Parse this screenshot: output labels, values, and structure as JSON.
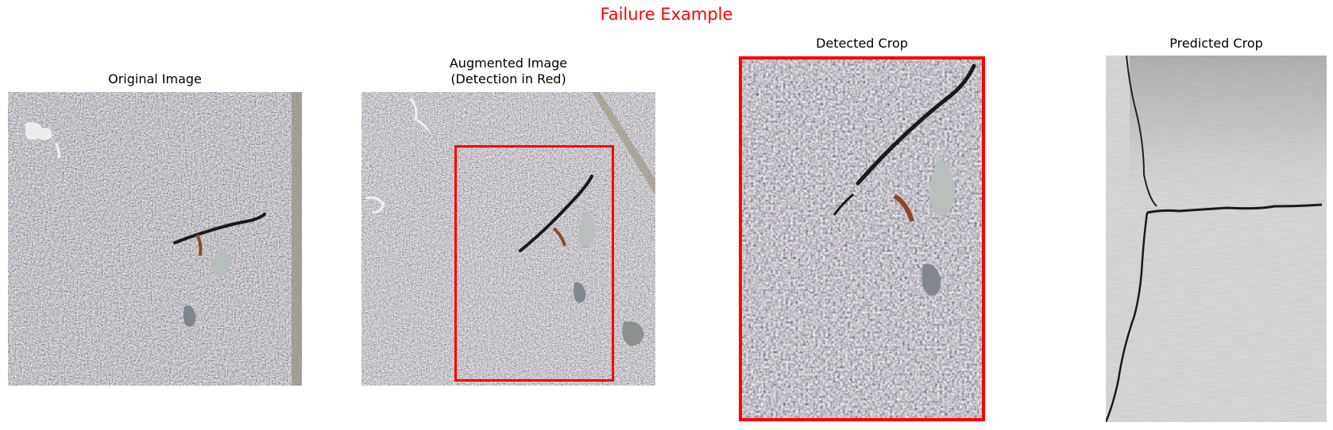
{
  "figure": {
    "suptitle": "Failure Example",
    "suptitle_color": "#ff0000",
    "detection_color": "#ff0000"
  },
  "panels": [
    {
      "title_lines": [
        "Original Image"
      ],
      "content": "asphalt-crack-photo"
    },
    {
      "title_lines": [
        "Augmented Image",
        "(Detection in Red)"
      ],
      "content": "augmented-asphalt-photo-with-detection-box"
    },
    {
      "title_lines": [
        "Detected Crop"
      ],
      "content": "detected-crop-photo"
    },
    {
      "title_lines": [
        "Predicted Crop"
      ],
      "content": "concrete-wall-crack-photo"
    }
  ]
}
